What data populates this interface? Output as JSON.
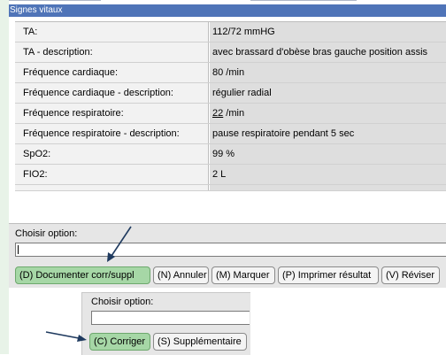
{
  "section": {
    "title": "Signes vitaux"
  },
  "vitals": [
    {
      "label": "TA:",
      "value": "112/72  mmHG"
    },
    {
      "label": "TA - description:",
      "value": "avec brassard d'obèse bras gauche position assis"
    },
    {
      "label": "Fréquence cardiaque:",
      "value": "80  /min"
    },
    {
      "label": "Fréquence cardiaque - description:",
      "value": "régulier radial"
    },
    {
      "label": "Fréquence respiratoire:",
      "value_num": "22",
      "value_unit": " /min"
    },
    {
      "label": "Fréquence respiratoire - description:",
      "value": "pause respiratoire pendant 5 sec"
    },
    {
      "label": "SpO2:",
      "value": "99  %"
    },
    {
      "label": "FIO2:",
      "value": "2  L"
    }
  ],
  "option_panel": {
    "label": "Choisir option:",
    "input_value": "",
    "buttons": [
      "(D) Documenter corr/suppl",
      "(N) Annuler",
      "(M) Marquer",
      "(P) Imprimer résultat",
      "(V) Réviser"
    ]
  },
  "correction_dialog": {
    "label": "Choisir option:",
    "input_value": "",
    "buttons": [
      "(C) Corriger",
      "(S) Supplémentaire"
    ]
  },
  "colors": {
    "header_blue": "#4f74b8",
    "highlight_green": "#a6d7a6",
    "arrow": "#1f3a5f"
  }
}
